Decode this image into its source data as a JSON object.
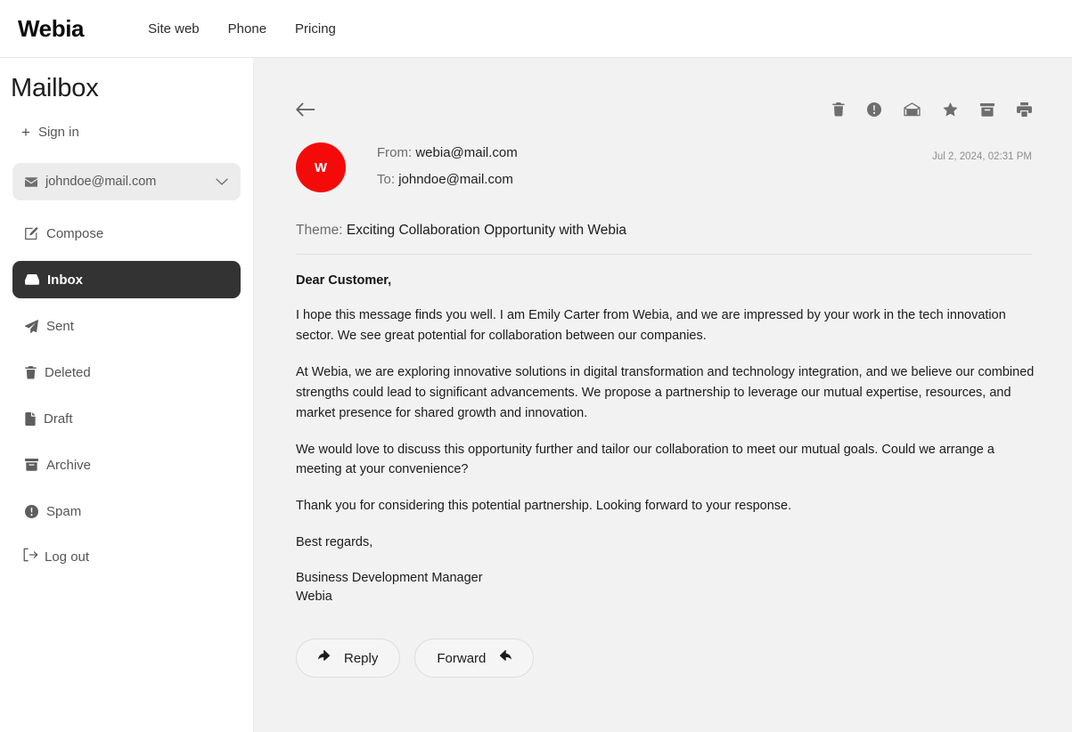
{
  "topnav": {
    "brand": "Webia",
    "links": [
      {
        "label": "Site web",
        "name": "nav-link-site-web"
      },
      {
        "label": "Phone",
        "name": "nav-link-phone"
      },
      {
        "label": "Pricing",
        "name": "nav-link-pricing"
      }
    ]
  },
  "sidebar": {
    "title": "Mailbox",
    "signin": {
      "label": "Sign in",
      "icon": "plus-icon"
    },
    "account": {
      "email": "johndoe@mail.com",
      "icon": "envelope-icon",
      "chevron": "chevron-down-icon"
    },
    "items": [
      {
        "label": "Compose",
        "icon": "compose-icon",
        "active": false
      },
      {
        "label": "Inbox",
        "icon": "inbox-icon",
        "active": true
      },
      {
        "label": "Sent",
        "icon": "paper-plane-icon",
        "active": false
      },
      {
        "label": "Deleted",
        "icon": "trash-icon",
        "active": false
      },
      {
        "label": "Draft",
        "icon": "file-icon",
        "active": false
      },
      {
        "label": "Archive",
        "icon": "archive-icon",
        "active": false
      },
      {
        "label": "Spam",
        "icon": "exclamation-circle-icon",
        "active": false
      }
    ],
    "logout": {
      "label": "Log out",
      "icon": "logout-icon"
    }
  },
  "mail": {
    "back_icon": "arrow-left-icon",
    "toolbar": [
      {
        "name": "delete-button",
        "icon": "trash-icon"
      },
      {
        "name": "report-spam-button",
        "icon": "exclamation-circle-icon"
      },
      {
        "name": "mark-unread-button",
        "icon": "open-envelope-icon"
      },
      {
        "name": "star-button",
        "icon": "star-icon"
      },
      {
        "name": "archive-button",
        "icon": "archive-icon"
      },
      {
        "name": "print-button",
        "icon": "printer-icon"
      }
    ],
    "avatar_letter": "W",
    "avatar_color": "#f50a0a",
    "from_label": "From:",
    "from_address": "webia@mail.com",
    "to_label": "To:",
    "to_address": "johndoe@mail.com",
    "date": "Jul 2, 2024, 02:31 PM",
    "theme_label": "Theme:",
    "theme_value": "Exciting Collaboration Opportunity with Webia",
    "greeting": "Dear Customer,",
    "paragraphs": [
      "I hope this message finds you well. I am Emily Carter from Webia, and we are impressed by your work in the tech innovation sector. We see great potential for collaboration between our companies.",
      "At Webia, we are exploring innovative solutions in digital transformation and technology integration, and we believe our combined strengths could lead to significant advancements. We propose a partnership to leverage our mutual expertise, resources, and market presence for shared growth and innovation.",
      "We would love to discuss this opportunity further and tailor our collaboration to meet our mutual goals. Could we arrange a meeting at your convenience?",
      "Thank you for considering this potential partnership. Looking forward to your response.",
      "Best regards,"
    ],
    "signature_role": "Business Development Manager",
    "signature_company": "Webia",
    "reply_label": "Reply",
    "forward_label": "Forward"
  }
}
